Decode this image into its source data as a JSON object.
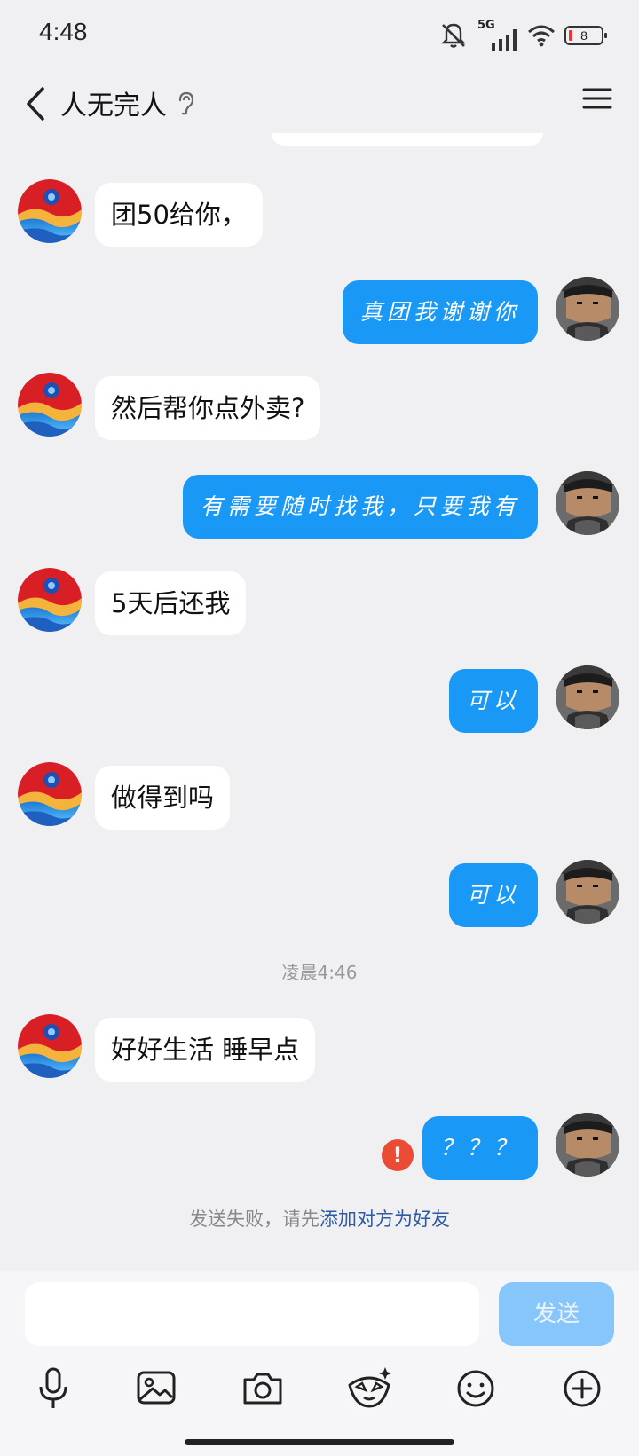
{
  "status": {
    "time": "4:48",
    "network": "5G",
    "battery": "8"
  },
  "header": {
    "title": "人无完人"
  },
  "messages": [
    {
      "dir": "in",
      "text": "团50给你，"
    },
    {
      "dir": "out",
      "text": "真团我谢谢你"
    },
    {
      "dir": "in",
      "text": "然后帮你点外卖?"
    },
    {
      "dir": "out",
      "text": "有需要随时找我，只要我有"
    },
    {
      "dir": "in",
      "text": "5天后还我"
    },
    {
      "dir": "out",
      "text": "可以"
    },
    {
      "dir": "in",
      "text": "做得到吗"
    },
    {
      "dir": "out",
      "text": "可以"
    },
    {
      "dir": "in",
      "text": "好好生活 睡早点"
    },
    {
      "dir": "out",
      "text": "？？？"
    }
  ],
  "time_separator": "凌晨4:46",
  "error_mark": "!",
  "fail_notice": {
    "prefix": "发送失败，请先",
    "link": "添加对方为好友"
  },
  "composer": {
    "send_label": "发送",
    "placeholder": ""
  },
  "toolbar": [
    "mic-icon",
    "image-icon",
    "camera-icon",
    "sticker-icon",
    "emoji-icon",
    "plus-icon"
  ],
  "colors": {
    "outgoing_bubble": "#1a98f6",
    "send_button": "#86c6fb",
    "error": "#e94b35",
    "link": "#2e5aa3"
  }
}
